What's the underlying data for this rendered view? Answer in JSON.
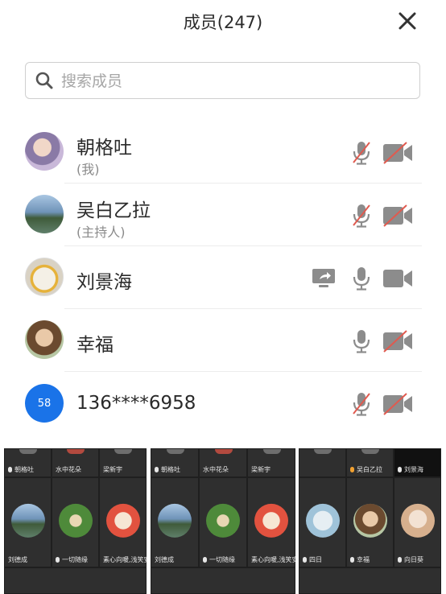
{
  "header": {
    "title": "成员(247)"
  },
  "search": {
    "placeholder": "搜索成员"
  },
  "members": [
    {
      "name": "朝格吐",
      "sub": "(我)",
      "mic": "muted",
      "camera": "off"
    },
    {
      "name": "吴白乙拉",
      "sub": "(主持人)",
      "mic": "muted",
      "camera": "off"
    },
    {
      "name": "刘景海",
      "sub": "",
      "mic": "on",
      "camera": "on",
      "sharing": true
    },
    {
      "name": "幸福",
      "sub": "",
      "mic": "on",
      "camera": "off"
    },
    {
      "name": "136****6958",
      "sub": "",
      "mic": "muted",
      "camera": "off",
      "avatar_text": "58"
    }
  ],
  "thumb_panels": [
    {
      "top_labels": [
        "朝格吐",
        "水中花朵",
        "梁新宇"
      ],
      "bottom_labels": [
        "刘德成",
        "一切随缘",
        "素心向暖,浅笑安然"
      ]
    },
    {
      "top_labels": [
        "朝格吐",
        "水中花朵",
        "梁新宇"
      ],
      "bottom_labels": [
        "刘德成",
        "一切随缘",
        "素心向暖,浅笑安然"
      ]
    },
    {
      "top_labels": [
        "",
        "吴白乙拉",
        "刘景海"
      ],
      "bottom_labels": [
        "四日",
        "幸福",
        "向日葵"
      ]
    }
  ],
  "colors": {
    "accent_blue": "#1a73e8",
    "muted_red": "#e05a4f",
    "icon_gray": "#8c8c8c"
  }
}
